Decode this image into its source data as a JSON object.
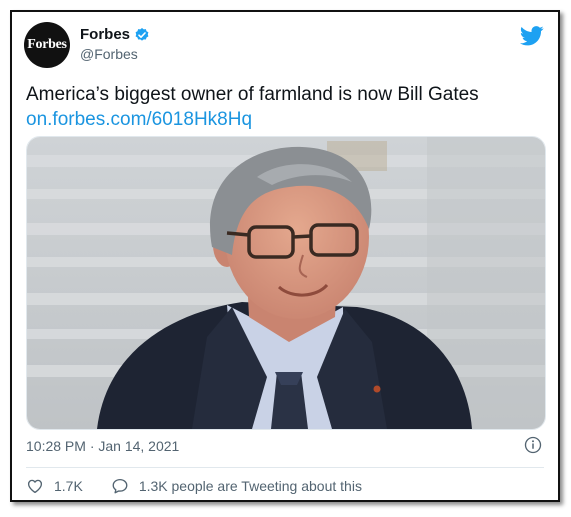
{
  "account": {
    "avatar_text": "Forbes",
    "name": "Forbes",
    "handle": "@Forbes"
  },
  "tweet": {
    "text": "America’s biggest owner of farmland is now Bill Gates",
    "link": "on.forbes.com/6018Hk8Hq",
    "timestamp": "10:28 PM · Jan 14, 2021"
  },
  "actions": {
    "likes": "1.7K",
    "conversation": "1.3K people are Tweeting about this"
  },
  "icons": {
    "verified": "verified-badge-icon",
    "bird": "twitter-bird-icon",
    "info": "info-icon",
    "like": "heart-icon",
    "reply": "speech-bubble-icon"
  },
  "colors": {
    "link": "#1b95e0",
    "verified": "#1da1f2",
    "secondary_text": "#536471"
  }
}
